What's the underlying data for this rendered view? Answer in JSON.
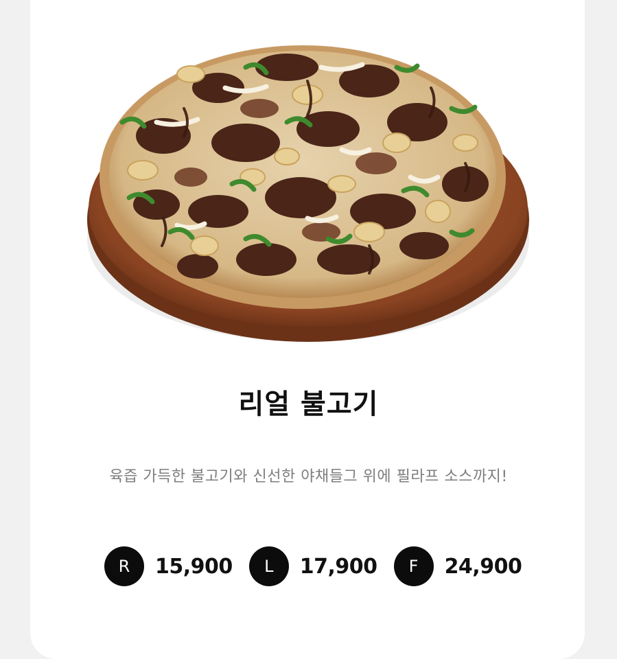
{
  "product": {
    "image_alt": "리얼 불고기 피자",
    "name": "리얼 불고기",
    "description": "육즙 가득한 불고기와 신선한 야채들그 위에 필라프 소스까지!"
  },
  "prices": [
    {
      "size": "R",
      "price": "15,900"
    },
    {
      "size": "L",
      "price": "17,900"
    },
    {
      "size": "F",
      "price": "24,900"
    }
  ],
  "colors": {
    "badge_bg": "#0c0c0c",
    "title_text": "#111111",
    "description_text": "#7d7d7d",
    "card_bg": "#ffffff"
  }
}
